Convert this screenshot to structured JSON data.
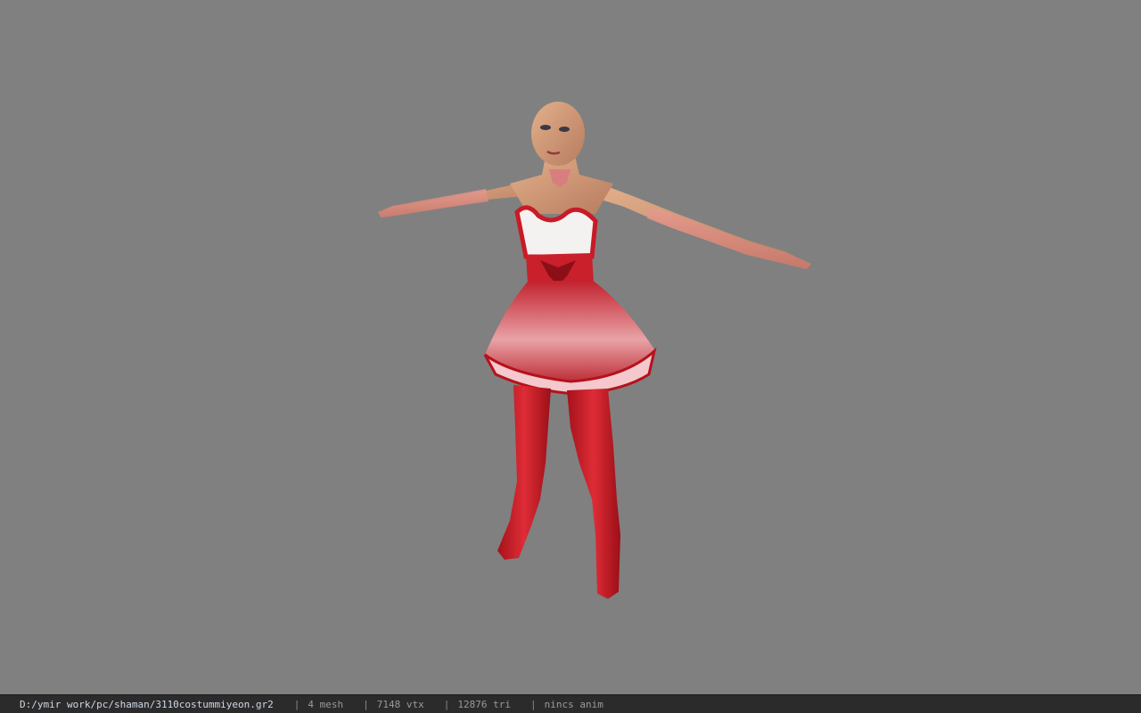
{
  "viewer": {
    "model_name": "character-model",
    "background_color": "#808080"
  },
  "status_bar": {
    "file_path": "D:/ymir work/pc/shaman/3110costummiyeon.gr2",
    "separator": "|",
    "mesh_count": "4 mesh",
    "vertex_count": "7148 vtx",
    "triangle_count": "12876 tri",
    "animation": "nincs anim"
  }
}
